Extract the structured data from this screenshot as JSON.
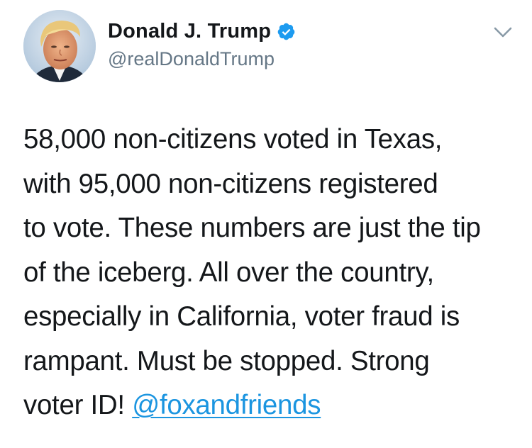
{
  "author": {
    "display_name": "Donald J. Trump",
    "handle": "@realDonaldTrump",
    "verified": true,
    "verified_icon": "verified-badge-icon",
    "avatar_icon": "profile-photo"
  },
  "menu": {
    "icon": "chevron-down-icon"
  },
  "tweet": {
    "lines": [
      "58,000 non-citizens voted in Texas,",
      "with 95,000 non-citizens registered",
      "to vote. These numbers are just the tip",
      "of the iceberg. All over the country,",
      "especially in California, voter fraud is",
      "rampant. Must be stopped. Strong"
    ],
    "last_line_text": "voter ID! ",
    "mention": "@foxandfriends"
  },
  "colors": {
    "text": "#14171a",
    "handle": "#657786",
    "link": "#1b95e0",
    "verified": "#1d9bf0"
  }
}
